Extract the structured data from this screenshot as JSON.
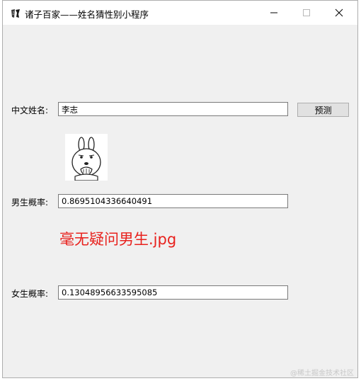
{
  "window": {
    "title": "诸子百家——姓名猜性别小程序",
    "app_icon": "scroll-brush-icon",
    "controls": {
      "minimize": "minimize-icon",
      "maximize": "maximize-icon",
      "close": "close-icon"
    }
  },
  "form": {
    "name_label": "中文姓名:",
    "name_value": "李志",
    "predict_button": "预测",
    "male_label": "男生概率:",
    "male_probability": "0.8695104336640491",
    "result_image": "sticker-face-image",
    "verdict": "毫无疑问男生.jpg",
    "female_label": "女生概率:",
    "female_probability": "0.13048956633595085"
  },
  "watermark": "@稀土掘金技术社区",
  "colors": {
    "window_bg": "#f0f0f0",
    "titlebar_bg": "#ffffff",
    "verdict_text": "#e8211d",
    "button_bg": "#e1e1e1"
  }
}
